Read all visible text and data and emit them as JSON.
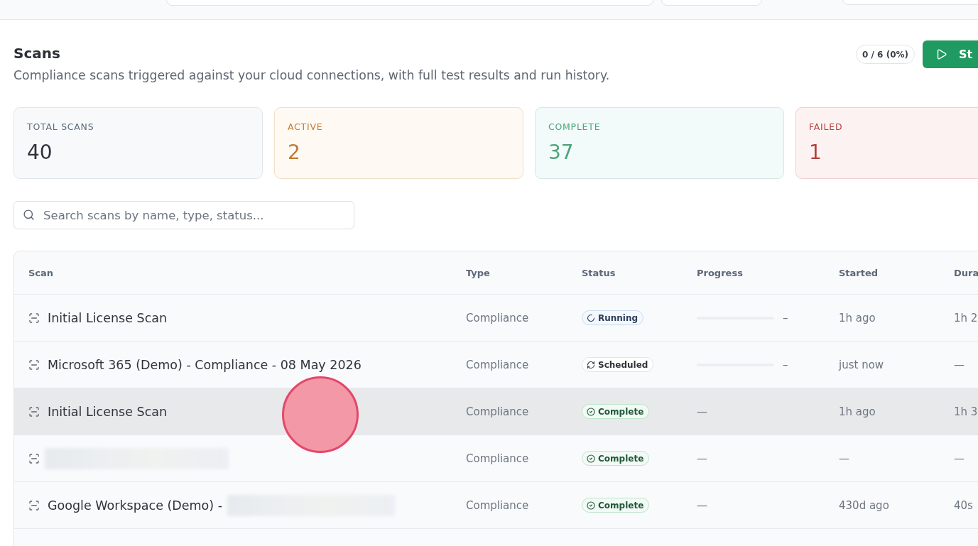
{
  "header": {
    "title": "Scans",
    "subtitle": "Compliance scans triggered against your cloud connections, with full test results and run history.",
    "completion_count": "0 / 6 (0%)",
    "primary_button": "St"
  },
  "stats": [
    {
      "kind": "total",
      "label": "TOTAL SCANS",
      "value": "40"
    },
    {
      "kind": "active",
      "label": "ACTIVE",
      "value": "2"
    },
    {
      "kind": "complete",
      "label": "COMPLETE",
      "value": "37"
    },
    {
      "kind": "failed",
      "label": "FAILED",
      "value": "1"
    }
  ],
  "search": {
    "placeholder": "Search scans by name, type, status..."
  },
  "table": {
    "columns": [
      "Scan",
      "Type",
      "Status",
      "Progress",
      "Started",
      "Dura"
    ],
    "rows": [
      {
        "name": "Initial License Scan",
        "redacted": false,
        "highlighted": false,
        "type": "Compliance",
        "status": {
          "kind": "running",
          "label": "Running"
        },
        "progress": {
          "kind": "bar",
          "level": 0,
          "reading": "–"
        },
        "started": "1h ago",
        "duration": "1h 2"
      },
      {
        "name": "Microsoft 365 (Demo) - Compliance - 08 May 2026",
        "redacted": false,
        "highlighted": false,
        "type": "Compliance",
        "status": {
          "kind": "scheduled",
          "label": "Scheduled"
        },
        "progress": {
          "kind": "bar",
          "level": 0,
          "reading": "–"
        },
        "started": "just now",
        "duration": "—"
      },
      {
        "name": "Initial License Scan",
        "redacted": false,
        "highlighted": true,
        "type": "Compliance",
        "status": {
          "kind": "complete",
          "label": "Complete"
        },
        "progress": {
          "kind": "text",
          "text": "—"
        },
        "started": "1h ago",
        "duration": "1h 3"
      },
      {
        "redacted": true,
        "highlighted": false,
        "type": "Compliance",
        "status": {
          "kind": "complete",
          "label": "Complete"
        },
        "progress": {
          "kind": "text",
          "text": "—"
        },
        "started": "—",
        "duration": "—"
      },
      {
        "name": "Google Workspace (Demo) -",
        "redacted": true,
        "highlighted": false,
        "type": "Compliance",
        "status": {
          "kind": "complete",
          "label": "Complete"
        },
        "progress": {
          "kind": "text",
          "text": "—"
        },
        "started": "430d ago",
        "duration": "40s"
      }
    ]
  }
}
